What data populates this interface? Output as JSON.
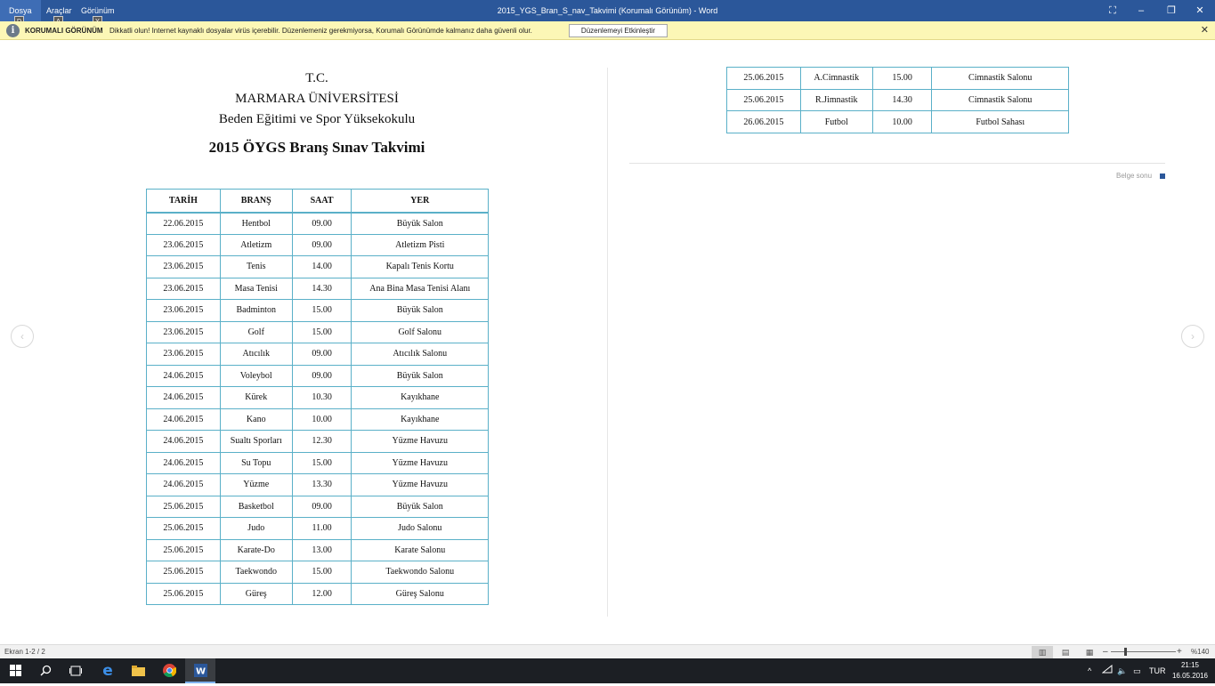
{
  "titlebar": {
    "menu": [
      {
        "label": "Dosya",
        "keytip": "D"
      },
      {
        "label": "Araçlar",
        "keytip": "A"
      },
      {
        "label": "Görünüm",
        "keytip": "Y"
      }
    ],
    "window_title": "2015_YGS_Bran_S_nav_Takvimi (Korumalı Görünüm) - Word",
    "buttons": {
      "fullscreen": "⛶",
      "minimize": "–",
      "restore": "❐",
      "close": "✕"
    }
  },
  "protected_view": {
    "label": "KORUMALI GÖRÜNÜM",
    "message": "Dikkatli olun! Internet kaynaklı dosyalar virüs içerebilir. Düzenlemeniz gerekmiyorsa, Korumalı Görünümde kalmanız daha güvenli olur.",
    "enable_button": "Düzenlemeyi Etkinleştir",
    "close": "✕"
  },
  "document": {
    "heading_lines": [
      "T.C.",
      "MARMARA ÜNİVERSİTESİ",
      "Beden Eğitimi ve Spor Yüksekokulu"
    ],
    "title": "2015 ÖYGS Branş Sınav Takvimi",
    "table_headers": [
      "TARİH",
      "BRANŞ",
      "SAAT",
      "YER"
    ],
    "rows_page1": [
      [
        "22.06.2015",
        "Hentbol",
        "09.00",
        "Büyük Salon"
      ],
      [
        "23.06.2015",
        "Atletizm",
        "09.00",
        "Atletizm Pisti"
      ],
      [
        "23.06.2015",
        "Tenis",
        "14.00",
        "Kapalı Tenis Kortu"
      ],
      [
        "23.06.2015",
        "Masa Tenisi",
        "14.30",
        "Ana Bina Masa Tenisi Alanı"
      ],
      [
        "23.06.2015",
        "Badminton",
        "15.00",
        "Büyük Salon"
      ],
      [
        "23.06.2015",
        "Golf",
        "15.00",
        "Golf Salonu"
      ],
      [
        "23.06.2015",
        "Atıcılık",
        "09.00",
        "Atıcılık Salonu"
      ],
      [
        "24.06.2015",
        "Voleybol",
        "09.00",
        "Büyük Salon"
      ],
      [
        "24.06.2015",
        "Kürek",
        "10.30",
        "Kayıkhane"
      ],
      [
        "24.06.2015",
        "Kano",
        "10.00",
        "Kayıkhane"
      ],
      [
        "24.06.2015",
        "Sualtı Sporları",
        "12.30",
        "Yüzme Havuzu"
      ],
      [
        "24.06.2015",
        "Su Topu",
        "15.00",
        "Yüzme Havuzu"
      ],
      [
        "24.06.2015",
        "Yüzme",
        "13.30",
        "Yüzme Havuzu"
      ],
      [
        "25.06.2015",
        "Basketbol",
        "09.00",
        "Büyük Salon"
      ],
      [
        "25.06.2015",
        "Judo",
        "11.00",
        "Judo Salonu"
      ],
      [
        "25.06.2015",
        "Karate-Do",
        "13.00",
        "Karate Salonu"
      ],
      [
        "25.06.2015",
        "Taekwondo",
        "15.00",
        "Taekwondo Salonu"
      ],
      [
        "25.06.2015",
        "Güreş",
        "12.00",
        "Güreş Salonu"
      ]
    ],
    "rows_page2": [
      [
        "25.06.2015",
        "A.Cimnastik",
        "15.00",
        "Cimnastik Salonu"
      ],
      [
        "25.06.2015",
        "R.Jimnastik",
        "14.30",
        "Cimnastik Salonu"
      ],
      [
        "26.06.2015",
        "Futbol",
        "10.00",
        "Futbol Sahası"
      ]
    ],
    "end_label": "Belge sonu"
  },
  "nav": {
    "prev": "‹",
    "next": "›"
  },
  "statusbar": {
    "page_info": "Ekran 1-2 / 2",
    "zoom_level": "%140",
    "zoom_minus": "–",
    "zoom_plus": "+"
  },
  "taskbar": {
    "language": "TUR",
    "time": "21:15",
    "date": "16.05.2016"
  },
  "colors": {
    "accent": "#2b579a",
    "table_border": "#5ab0c8",
    "protected_bar": "#fcf7b6"
  }
}
